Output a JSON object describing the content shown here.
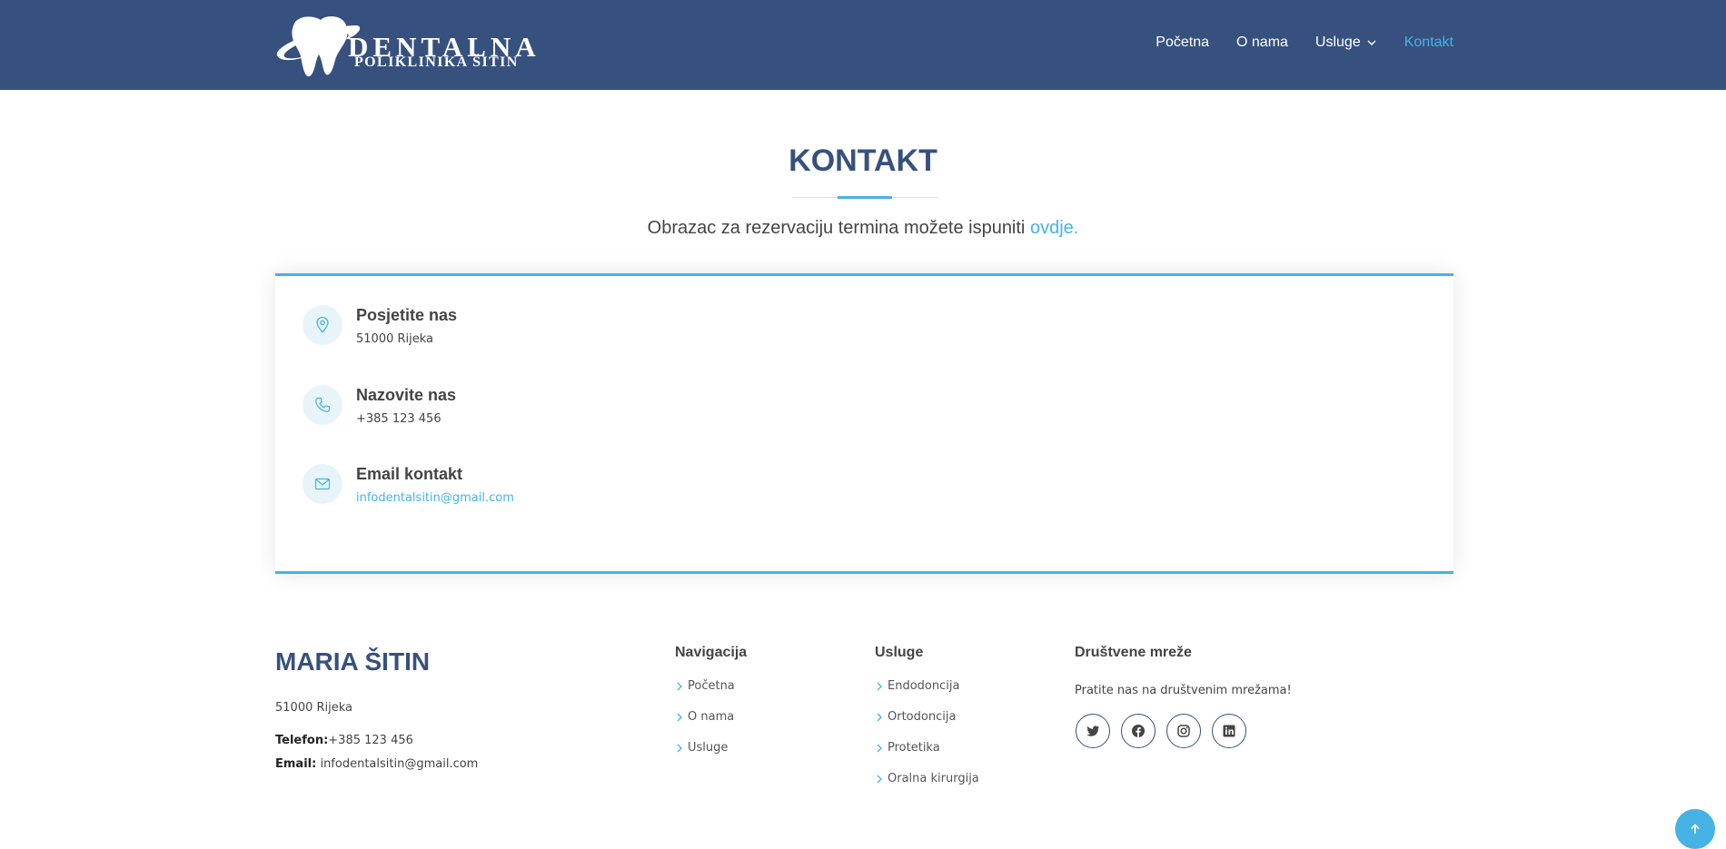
{
  "header": {
    "logo_line1": "DENTALNA",
    "logo_line2": "POLIKLINIKA ŠITIN",
    "nav": [
      {
        "label": "Početna",
        "active": false
      },
      {
        "label": "O nama",
        "active": false
      },
      {
        "label": "Usluge",
        "active": false,
        "has_dropdown": true
      },
      {
        "label": "Kontakt",
        "active": true
      }
    ]
  },
  "section": {
    "title": "Kontakt",
    "subtitle_text": "Obrazac za rezervaciju termina možete ispuniti",
    "subtitle_link": "ovdje."
  },
  "info": {
    "visit": {
      "title": "Posjetite nas",
      "text": "51000 Rijeka",
      "icon": "map-pin-icon"
    },
    "call": {
      "title": "Nazovite nas",
      "text": "+385 123 456",
      "icon": "phone-icon"
    },
    "email": {
      "title": "Email kontakt",
      "text": "infodentalsitin@gmail.com",
      "icon": "envelope-icon"
    }
  },
  "footer": {
    "brand": "Maria Šitin",
    "address": "51000 Rijeka",
    "phone_label": "Telefon:",
    "phone": "+385 123 456",
    "email_label": "Email:",
    "email": "infodentalsitin@gmail.com",
    "nav_heading": "Navigacija",
    "nav_links": [
      "Početna",
      "O nama",
      "Usluge"
    ],
    "services_heading": "Usluge",
    "services_links": [
      "Endodoncija",
      "Ortodoncija",
      "Protetika",
      "Oralna kirurgija"
    ],
    "social_heading": "Društvene mreže",
    "social_text": "Pratite nas na društvenim mrežama!",
    "social_icons": [
      "twitter-icon",
      "facebook-icon",
      "instagram-icon",
      "linkedin-icon"
    ]
  },
  "colors": {
    "brand": "#37517e",
    "accent": "#47b2e4",
    "text": "#444444"
  }
}
